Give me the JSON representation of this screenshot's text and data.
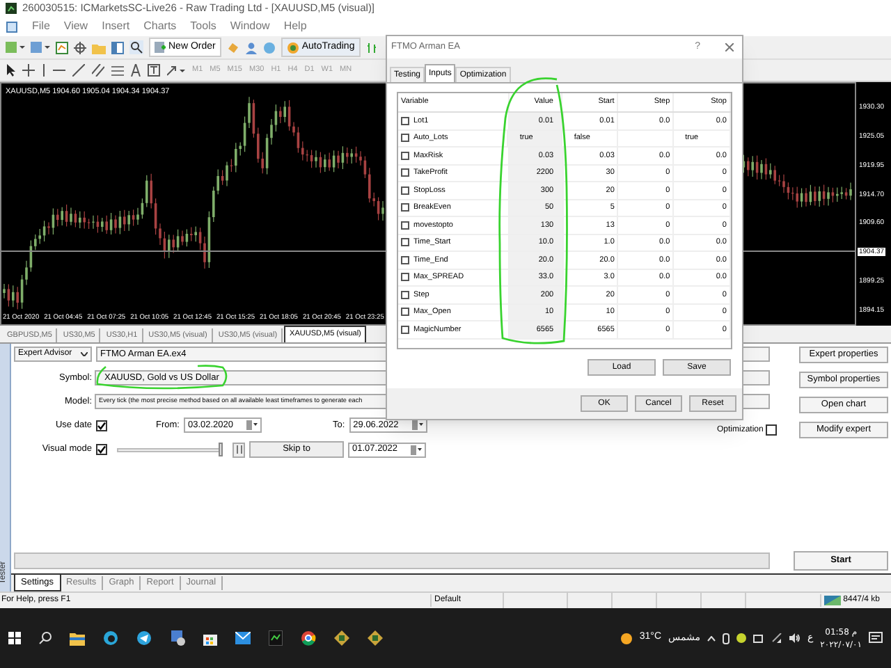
{
  "window": {
    "title": "260030515: ICMarketsSC-Live26 - Raw Trading Ltd - [XAUUSD,M5 (visual)]"
  },
  "menu": [
    "File",
    "View",
    "Insert",
    "Charts",
    "Tools",
    "Window",
    "Help"
  ],
  "toolbar": {
    "new_order": "New Order",
    "autotrading": "AutoTrading",
    "timeframes": [
      "M1",
      "M5",
      "M15",
      "M30",
      "H1",
      "H4",
      "D1",
      "W1",
      "MN"
    ]
  },
  "chart": {
    "header": "XAUUSD,M5  1904.60 1905.04 1904.34 1904.37",
    "price_labels": [
      {
        "kind": "tick",
        "text": "1930.30"
      },
      {
        "kind": "tick",
        "text": "1925.05"
      },
      {
        "kind": "tick",
        "text": "1919.95"
      },
      {
        "kind": "tick",
        "text": "1914.70"
      },
      {
        "kind": "tick",
        "text": "1909.60"
      },
      {
        "kind": "current",
        "text": "1904.37"
      },
      {
        "kind": "tick",
        "text": "1899.25"
      },
      {
        "kind": "tick",
        "text": "1894.15"
      }
    ],
    "time_labels": [
      "21 Oct 2020",
      "21 Oct 04:45",
      "21 Oct 07:25",
      "21 Oct 10:05",
      "21 Oct 12:45",
      "21 Oct 15:25",
      "21 Oct 18:05",
      "21 Oct 20:45",
      "21 Oct 23:25"
    ]
  },
  "chart_tabs": [
    {
      "label": "GBPUSD,M5",
      "selected": false
    },
    {
      "label": "US30,M5",
      "selected": false
    },
    {
      "label": "US30,H1",
      "selected": false
    },
    {
      "label": "US30,M5 (visual)",
      "selected": false
    },
    {
      "label": "US30,M5 (visual)",
      "selected": false
    },
    {
      "label": "XAUUSD,M5 (visual)",
      "selected": true
    }
  ],
  "tester": {
    "side_label": "Tester",
    "type": "Expert Advisor",
    "expert": "FTMO Arman EA.ex4",
    "symbol_label": "Symbol:",
    "symbol": "XAUUSD, Gold vs US Dollar",
    "model_label": "Model:",
    "model": "Every tick (the most precise method based on all available least timeframes to generate each",
    "use_date": {
      "label": "Use date",
      "checked": true
    },
    "from_label": "From:",
    "from": "03.02.2020",
    "to_label": "To:",
    "to": "29.06.2022",
    "visual_mode": {
      "label": "Visual mode",
      "checked": true,
      "level": 1
    },
    "skip_to": "Skip to",
    "skip_date": "01.07.2022",
    "optimization": {
      "label": "Optimization",
      "checked": false
    },
    "side_buttons": [
      "Expert properties",
      "Symbol properties",
      "Open chart",
      "Modify expert"
    ],
    "progress": {
      "level": 0
    },
    "start": "Start",
    "tabs": [
      {
        "label": "Settings",
        "selected": true
      },
      {
        "label": "Results",
        "selected": false
      },
      {
        "label": "Graph",
        "selected": false
      },
      {
        "label": "Report",
        "selected": false
      },
      {
        "label": "Journal",
        "selected": false
      }
    ]
  },
  "status_bar": {
    "help": "For Help, press F1",
    "profile": "Default",
    "traffic": "8447/4 kb"
  },
  "taskbar": {
    "temperature": "31°C",
    "condition": "مشمس",
    "language": "ع",
    "time": "01:58 م",
    "date": "٢٠٢٢/٠٧/٠١"
  },
  "dialog": {
    "title": "FTMO Arman EA",
    "help": "?",
    "tabs": [
      {
        "label": "Testing",
        "selected": false
      },
      {
        "label": "Inputs",
        "selected": true
      },
      {
        "label": "Optimization",
        "selected": false
      }
    ],
    "columns": [
      "Variable",
      "Value",
      "Start",
      "Step",
      "Stop"
    ],
    "rows": [
      {
        "kind": "number",
        "checked": false,
        "cells": [
          "Lot1",
          "0.01",
          "0.01",
          "0.0",
          "0.0"
        ]
      },
      {
        "kind": "bool",
        "checked": false,
        "cells": [
          "Auto_Lots",
          "true",
          "false",
          "",
          "true"
        ]
      },
      {
        "kind": "number",
        "checked": false,
        "cells": [
          "MaxRisk",
          "0.03",
          "0.03",
          "0.0",
          "0.0"
        ]
      },
      {
        "kind": "number",
        "checked": false,
        "cells": [
          "TakeProfit",
          "2200",
          "30",
          "0",
          "0"
        ]
      },
      {
        "kind": "number",
        "checked": false,
        "cells": [
          "StopLoss",
          "300",
          "20",
          "0",
          "0"
        ]
      },
      {
        "kind": "number",
        "checked": false,
        "cells": [
          "BreakEven",
          "50",
          "5",
          "0",
          "0"
        ]
      },
      {
        "kind": "number",
        "checked": false,
        "cells": [
          "movestopto",
          "130",
          "13",
          "0",
          "0"
        ]
      },
      {
        "kind": "number",
        "checked": false,
        "cells": [
          "Time_Start",
          "10.0",
          "1.0",
          "0.0",
          "0.0"
        ]
      },
      {
        "kind": "number",
        "checked": false,
        "cells": [
          "Time_End",
          "20.0",
          "20.0",
          "0.0",
          "0.0"
        ]
      },
      {
        "kind": "number",
        "checked": false,
        "cells": [
          "Max_SPREAD",
          "33.0",
          "3.0",
          "0.0",
          "0.0"
        ]
      },
      {
        "kind": "number",
        "checked": false,
        "cells": [
          "Step",
          "200",
          "20",
          "0",
          "0"
        ]
      },
      {
        "kind": "number",
        "checked": false,
        "cells": [
          "Max_Open",
          "10",
          "10",
          "0",
          "0"
        ]
      },
      {
        "kind": "number",
        "checked": false,
        "cells": [
          "MagicNumber",
          "6565",
          "6565",
          "0",
          "0"
        ]
      }
    ],
    "buttons": [
      "Load",
      "Save"
    ],
    "footer_buttons": [
      "OK",
      "Cancel",
      "Reset"
    ]
  }
}
